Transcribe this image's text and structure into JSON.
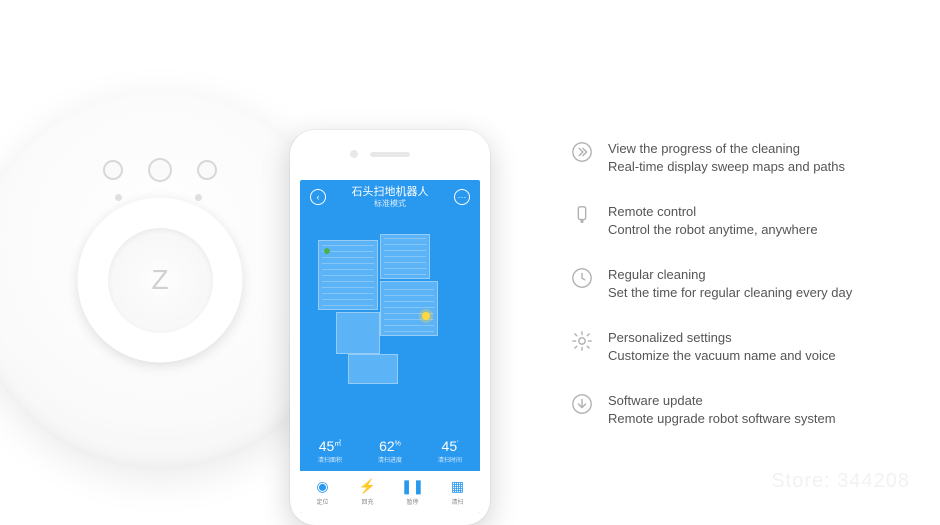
{
  "phone": {
    "app_title": "石头扫地机器人",
    "app_subtitle": "标准模式",
    "stats": [
      {
        "value": "45",
        "unit": "㎡",
        "label": "清扫面积"
      },
      {
        "value": "62",
        "unit": "%",
        "label": "清扫进度"
      },
      {
        "value": "45",
        "unit": "'",
        "label": "清扫时间"
      }
    ],
    "nav": [
      {
        "icon": "pin",
        "label": "定位"
      },
      {
        "icon": "bolt",
        "label": "回充"
      },
      {
        "icon": "pause",
        "label": "暂停"
      },
      {
        "icon": "grid",
        "label": "清扫"
      }
    ]
  },
  "features": [
    {
      "icon": "progress",
      "title": "View the progress of the cleaning",
      "desc": "Real-time display sweep maps and paths"
    },
    {
      "icon": "remote",
      "title": "Remote control",
      "desc": "Control  the robot anytime, anywhere"
    },
    {
      "icon": "clock",
      "title": "Regular cleaning",
      "desc": "Set the time for regular cleaning every day"
    },
    {
      "icon": "gear",
      "title": "Personalized settings",
      "desc": "Customize the vacuum name and voice"
    },
    {
      "icon": "download",
      "title": "Software update",
      "desc": "Remote upgrade robot software system"
    }
  ],
  "watermark": "Store: 344208",
  "robot_logo": "Z"
}
